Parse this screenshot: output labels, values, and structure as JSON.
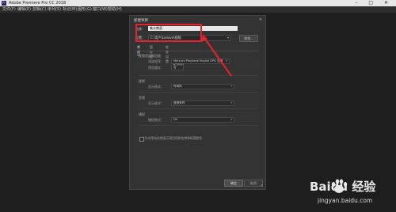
{
  "window": {
    "title": "Adobe Premiere Pro CC 2018",
    "icon_text": "Pr",
    "controls": "– □ ✕"
  },
  "menubar": {
    "items": [
      "文件(F)",
      "编辑(E)",
      "剪辑(C)",
      "序列(S)",
      "标记(M)",
      "图形(G)",
      "窗口(W)",
      "帮助(H)"
    ]
  },
  "dialog": {
    "title": "新建项目",
    "close": "×",
    "name_label": "名称：",
    "name_value": "集水教画",
    "location_label": "位置：",
    "location_value": "C:\\用户\\Lenovo\\视频",
    "browse_label": "浏览...",
    "tabs": [
      {
        "label": "常规",
        "active": true
      },
      {
        "label": "暂存盘",
        "active": false
      },
      {
        "label": "收录设置",
        "active": false
      }
    ],
    "sections": {
      "renderer": {
        "title": "视频渲染和回放",
        "renderer_label": "渲染程序：",
        "renderer_value": "Mercury Playback Engine GPU 加速 (CUDA)",
        "preview_label": "预览缓存：",
        "preview_value": "否"
      },
      "video": {
        "title": "视频",
        "format_label": "显示格式：",
        "format_value": "时间码"
      },
      "audio": {
        "title": "音频",
        "format_label": "显示格式：",
        "format_value": "音频采样"
      },
      "capture": {
        "title": "捕捉",
        "format_label": "捕捉格式：",
        "format_value": "DV"
      }
    },
    "checkbox_label": "针对所有实例显示项目项的名称和标签颜色",
    "ok_label": "确定",
    "cancel_label": "取消"
  },
  "annotation": {
    "highlight_color": "#e8222a",
    "arrow_color": "#e8222a"
  },
  "watermark": {
    "logo_text": "Baidu 经验",
    "url": "jingyan.baidu.com"
  }
}
